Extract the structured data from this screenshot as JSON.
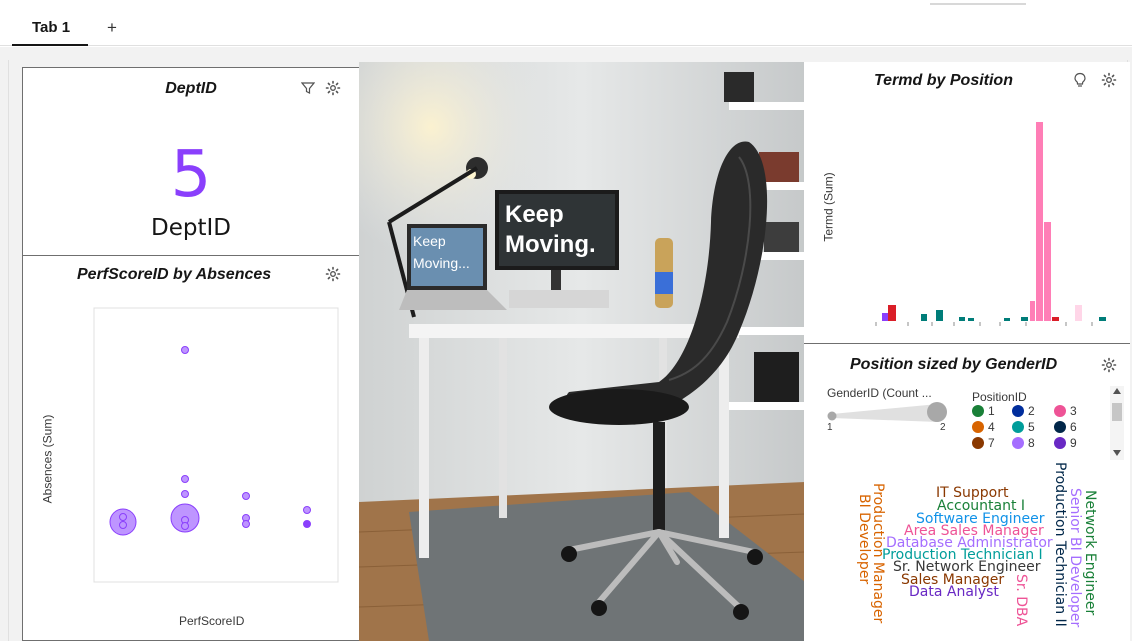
{
  "tabs": [
    {
      "label": "Tab 1"
    }
  ],
  "add_tab_label": "+",
  "kpi": {
    "title": "DeptID",
    "value": "5",
    "label": "DeptID"
  },
  "scatter": {
    "title": "PerfScoreID by Absences",
    "xlabel": "PerfScoreID",
    "ylabel": "Absences (Sum)"
  },
  "termd": {
    "title": "Termd by Position",
    "ylabel": "Termd (Sum)"
  },
  "position": {
    "title": "Position sized by GenderID",
    "size_legend_title": "GenderID (Count ...",
    "size_min": "1",
    "size_max": "2",
    "color_legend_title": "PositionID",
    "color_items": [
      {
        "label": "1",
        "color": "#198038"
      },
      {
        "label": "2",
        "color": "#002d9c"
      },
      {
        "label": "3",
        "color": "#ee5396"
      },
      {
        "label": "4",
        "color": "#d86400"
      },
      {
        "label": "5",
        "color": "#009d9a"
      },
      {
        "label": "6",
        "color": "#012749"
      },
      {
        "label": "7",
        "color": "#8a3800"
      },
      {
        "label": "8",
        "color": "#a56eff"
      },
      {
        "label": "9",
        "color": "#6929c4"
      }
    ],
    "words": [
      {
        "text": "IT Support",
        "color": "#8a3800"
      },
      {
        "text": "Accountant I",
        "color": "#198038"
      },
      {
        "text": "Software Engineer",
        "color": "#1192e8"
      },
      {
        "text": "Area Sales Manager",
        "color": "#ee5396"
      },
      {
        "text": "Database Administrator",
        "color": "#a56eff"
      },
      {
        "text": "Production Technician I",
        "color": "#009d9a"
      },
      {
        "text": "Sr. Network Engineer",
        "color": "#393939"
      },
      {
        "text": "Sales Manager",
        "color": "#8a3800"
      },
      {
        "text": "Data Analyst",
        "color": "#6929c4"
      },
      {
        "text": "Production Manager",
        "color": "#d86400"
      },
      {
        "text": "BI Developer",
        "color": "#d86400"
      },
      {
        "text": "Sr. DBA",
        "color": "#ee5396"
      },
      {
        "text": "Production Technician II",
        "color": "#012749"
      },
      {
        "text": "Senior BI Developer",
        "color": "#a56eff"
      },
      {
        "text": "Network Engineer",
        "color": "#198038"
      }
    ]
  },
  "photo": {
    "screen_text_large": "Keep\nMoving.",
    "laptop_text": "Keep\nMoving..."
  },
  "colors": {
    "accent": "#8a3ffc",
    "bubble_fill": "#be95ff",
    "bar_pink": "#ff7eb6",
    "bar_teal": "#007d79",
    "bar_red": "#da1e28"
  },
  "icons": [
    "filter-icon",
    "settings-icon",
    "lightbulb-icon"
  ]
}
